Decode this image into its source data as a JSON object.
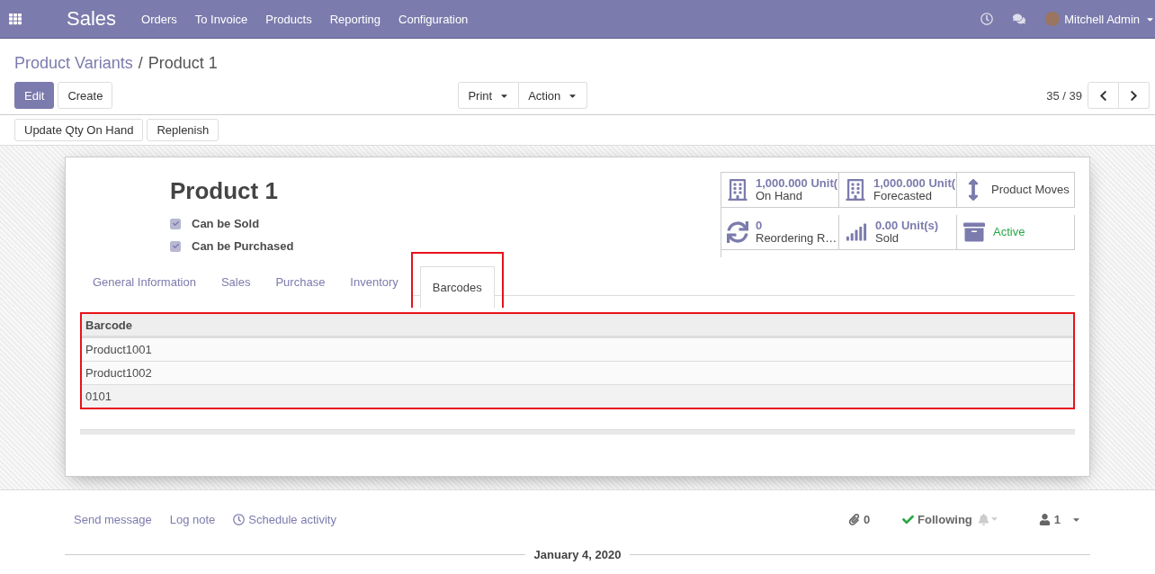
{
  "navbar": {
    "app": "Sales",
    "menu": [
      "Orders",
      "To Invoice",
      "Products",
      "Reporting",
      "Configuration"
    ],
    "user": "Mitchell Admin"
  },
  "breadcrumb": {
    "parent": "Product Variants",
    "separator": "/",
    "current": "Product 1"
  },
  "buttons": {
    "primary": "Edit",
    "secondary": "Create",
    "print": "Print",
    "action": "Action"
  },
  "pager": "35 / 39",
  "header_buttons": [
    "Update Qty On Hand",
    "Replenish"
  ],
  "product": {
    "name": "Product 1",
    "options": [
      {
        "label": "Can be Sold",
        "checked": true
      },
      {
        "label": "Can be Purchased",
        "checked": true
      }
    ]
  },
  "stat_buttons": [
    {
      "kind": "building",
      "value": "1,000.000",
      "unit": "Unit(",
      "label": "On Hand"
    },
    {
      "kind": "building",
      "value": "1,000.000",
      "unit": "Unit(",
      "label": "Forecasted"
    },
    {
      "kind": "arrows",
      "label": "Product Moves"
    },
    {
      "kind": "refresh",
      "value": "0",
      "label": "Reordering R…"
    },
    {
      "kind": "bars",
      "value": "0.00",
      "unit": "Unit(s)",
      "label": "Sold"
    },
    {
      "kind": "archive",
      "label": "Active",
      "active": true
    }
  ],
  "tabs": [
    {
      "label": "General Information",
      "selected": false
    },
    {
      "label": "Sales",
      "selected": false
    },
    {
      "label": "Purchase",
      "selected": false
    },
    {
      "label": "Inventory",
      "selected": false
    },
    {
      "label": "Barcodes",
      "selected": true
    }
  ],
  "table": {
    "columns": [
      "Barcode"
    ],
    "rows": [
      [
        "Product1001"
      ],
      [
        "Product1002"
      ],
      [
        "0101"
      ]
    ]
  },
  "chatter": {
    "actions": [
      "Send message",
      "Log note",
      "Schedule activity"
    ],
    "attachments": "0",
    "follow": "Following",
    "followers": "1",
    "date": "January 4, 2020"
  }
}
